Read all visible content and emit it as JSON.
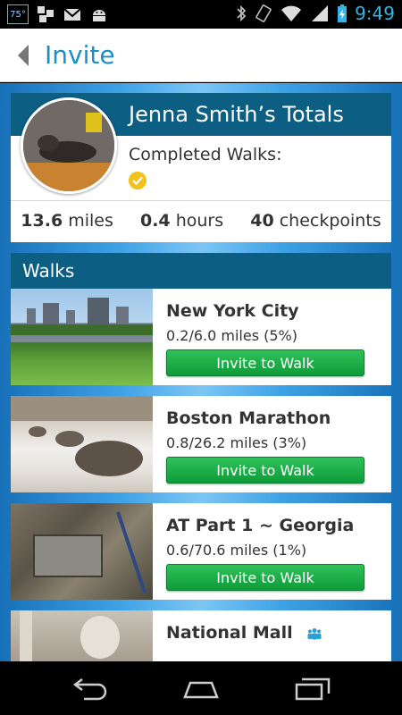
{
  "status_bar": {
    "temperature": "75°",
    "time": "9:49",
    "icons": [
      "windows-icon",
      "gmail-icon",
      "android-icon",
      "bluetooth-icon",
      "rotation-icon",
      "wifi-icon",
      "signal-icon",
      "battery-charging-icon"
    ]
  },
  "action_bar": {
    "title": "Invite"
  },
  "totals": {
    "title": "Jenna Smith’s Totals",
    "completed_label": "Completed Walks:",
    "miles_value": "13.6",
    "miles_unit": "miles",
    "hours_value": "0.4",
    "hours_unit": "hours",
    "checkpoints_value": "40",
    "checkpoints_unit": "checkpoints"
  },
  "walks": {
    "title": "Walks",
    "items": [
      {
        "name": "New York City",
        "progress": "0.2/6.0 miles (5%)",
        "button": "Invite to Walk",
        "thumb": "central-park-photo"
      },
      {
        "name": "Boston Marathon",
        "progress": "0.8/26.2 miles (3%)",
        "button": "Invite to Walk",
        "thumb": "boston-tortoise-statue-photo"
      },
      {
        "name": "AT Part 1 ~ Georgia",
        "progress": "0.6/70.6 miles (1%)",
        "button": "Invite to Walk",
        "thumb": "trail-plaque-photo"
      },
      {
        "name": "National Mall",
        "progress": "",
        "button": "",
        "thumb": "lincoln-memorial-photo",
        "group_icon": "group-icon"
      }
    ]
  },
  "colors": {
    "accent": "#1a8fc6",
    "header_dark_blue": "#0c5f83",
    "button_green": "#1aae48",
    "badge_gold": "#f2c21b"
  }
}
